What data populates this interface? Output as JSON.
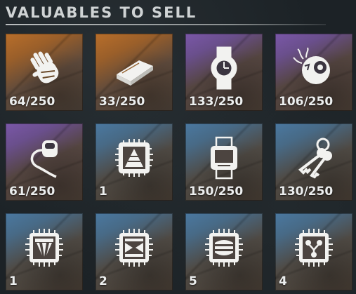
{
  "header": {
    "title": "VALUABLES TO SELL"
  },
  "items": [
    {
      "icon": "gloved-hand-icon",
      "count": "64/250",
      "rarity": "legendary"
    },
    {
      "icon": "gold-bar-icon",
      "count": "33/250",
      "rarity": "legendary"
    },
    {
      "icon": "wristwatch-icon",
      "count": "133/250",
      "rarity": "epic"
    },
    {
      "icon": "robot-eye-icon",
      "count": "106/250",
      "rarity": "epic"
    },
    {
      "icon": "hearing-aid-icon",
      "count": "61/250",
      "rarity": "epic"
    },
    {
      "icon": "chip-pyramid-icon",
      "count": "1",
      "rarity": "rare"
    },
    {
      "icon": "digital-watch-icon",
      "count": "150/250",
      "rarity": "rare"
    },
    {
      "icon": "keys-icon",
      "count": "130/250",
      "rarity": "rare"
    },
    {
      "icon": "chip-rays-icon",
      "count": "1",
      "rarity": "rare"
    },
    {
      "icon": "chip-hourglass-icon",
      "count": "2",
      "rarity": "rare"
    },
    {
      "icon": "chip-stripes-icon",
      "count": "5",
      "rarity": "rare"
    },
    {
      "icon": "chip-network-icon",
      "count": "4",
      "rarity": "rare"
    }
  ],
  "colors": {
    "legendary": "#b86e2a",
    "epic": "#7a57a8",
    "rare": "#4a78a0",
    "text": "#eceeee",
    "background": "#1c2226"
  }
}
